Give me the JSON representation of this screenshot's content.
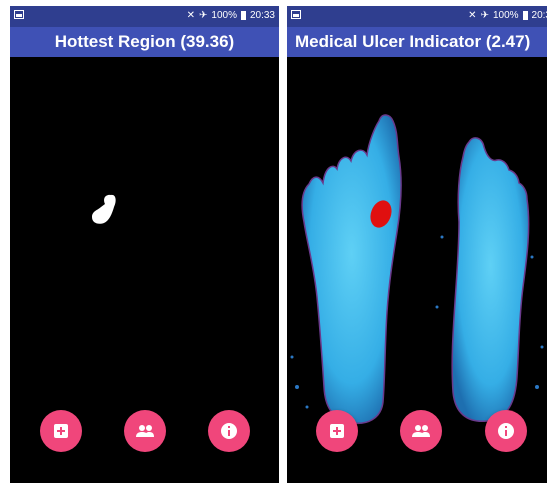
{
  "screens": [
    {
      "status": {
        "time": "20:33",
        "battery": "100%"
      },
      "title": "Hottest Region (39.36)",
      "fabs": [
        {
          "icon": "add-box-icon"
        },
        {
          "icon": "people-icon"
        },
        {
          "icon": "info-icon"
        }
      ]
    },
    {
      "status": {
        "time": "20:3",
        "battery": "100%"
      },
      "title": "Medical Ulcer Indicator (2.47)",
      "fabs": [
        {
          "icon": "add-box-icon"
        },
        {
          "icon": "people-icon"
        },
        {
          "icon": "info-icon"
        }
      ]
    }
  ],
  "colors": {
    "status_bar": "#2f3e8f",
    "app_bar": "#3f51b5",
    "fab": "#f0467b",
    "foot": "#39b4ea",
    "ulcer": "#e01010"
  }
}
